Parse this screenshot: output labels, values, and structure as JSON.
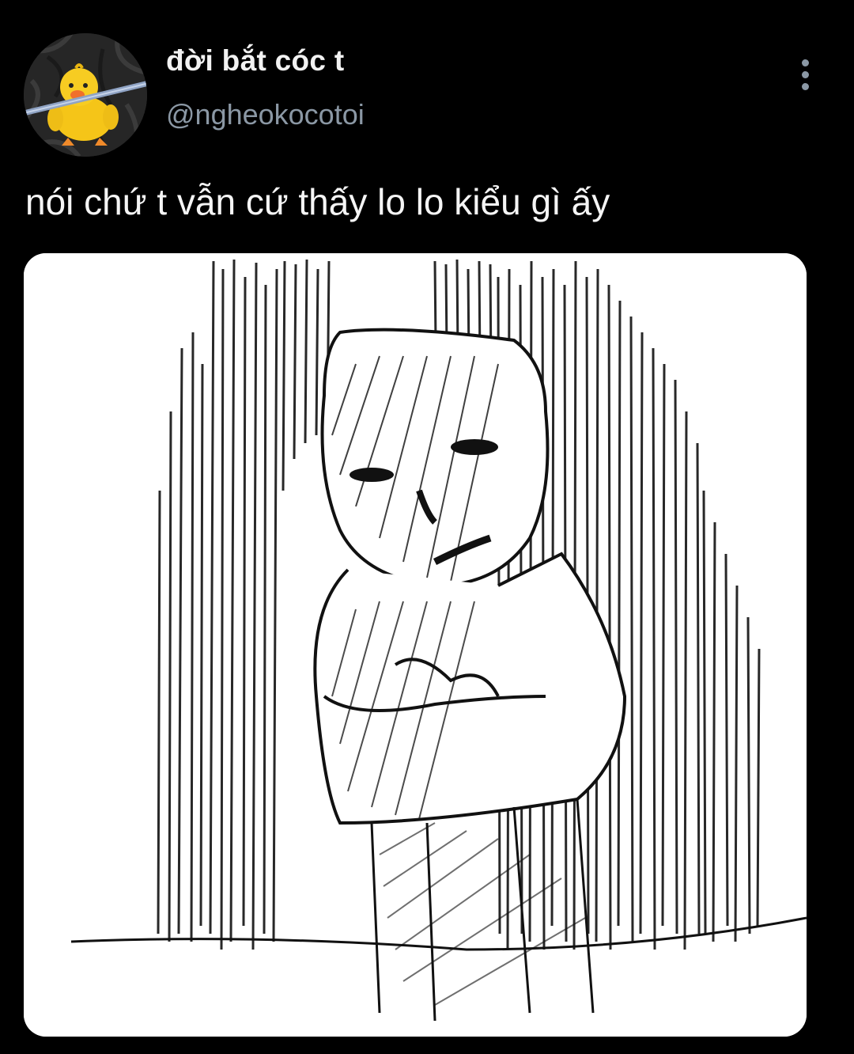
{
  "tweet": {
    "author": {
      "display_name": "đời bắt cóc t",
      "handle": "@ngheokocotoi",
      "avatar_icon": "yellow-duck-plush-avatar"
    },
    "more_icon": "more-vertical-icon",
    "text": "nói chứ t vẫn cứ thấy lo lo kiểu gì ấy",
    "media": {
      "kind": "image",
      "content": "black-and-white-sketch-anxious-figure"
    }
  },
  "theme": {
    "background": "#000000",
    "name_color": "#f2f2f2",
    "handle_color": "#8b98a5",
    "text_color": "#f5f5f5",
    "icon_color": "#8b98a5"
  }
}
